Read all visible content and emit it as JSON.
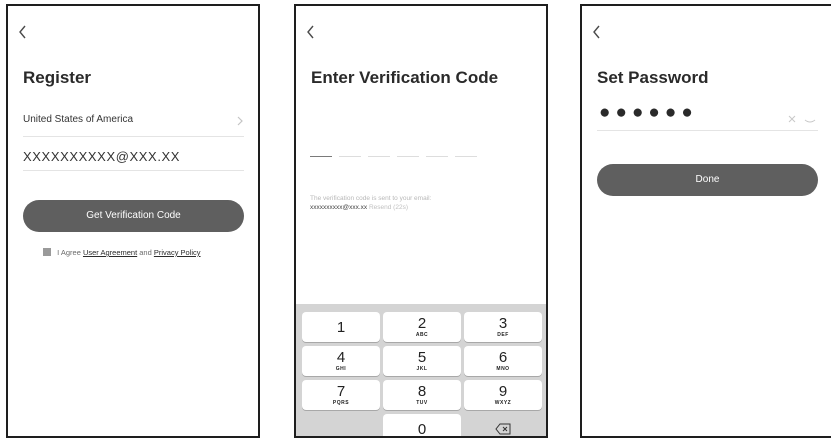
{
  "register": {
    "title": "Register",
    "country": "United States of America",
    "email": "XXXXXXXXXX@XXX.XX",
    "button_label": "Get Verification Code",
    "agree_prefix": "I Agree",
    "user_agreement": "User Agreement",
    "agree_and": "and",
    "privacy_policy": "Privacy Policy"
  },
  "verify": {
    "title": "Enter Verification Code",
    "hint": "The verification code is sent to your email:",
    "email": "xxxxxxxxxx@xxx.xx",
    "resend": "Resend (22s)",
    "keys": [
      {
        "num": "1",
        "letters": ""
      },
      {
        "num": "2",
        "letters": "ABC"
      },
      {
        "num": "3",
        "letters": "DEF"
      },
      {
        "num": "4",
        "letters": "GHI"
      },
      {
        "num": "5",
        "letters": "JKL"
      },
      {
        "num": "6",
        "letters": "MNO"
      },
      {
        "num": "7",
        "letters": "PQRS"
      },
      {
        "num": "8",
        "letters": "TUV"
      },
      {
        "num": "9",
        "letters": "WXYZ"
      },
      {
        "num": "0",
        "letters": ""
      }
    ]
  },
  "password": {
    "title": "Set Password",
    "masked": "●●●●●●",
    "button_label": "Done"
  },
  "icons": {
    "back": "chevron-left-icon",
    "country_arrow": "chevron-right-icon",
    "checkbox": "checkbox-checked-icon",
    "backspace": "backspace-icon",
    "clear": "clear-icon",
    "visibility": "eye-closed-icon"
  }
}
